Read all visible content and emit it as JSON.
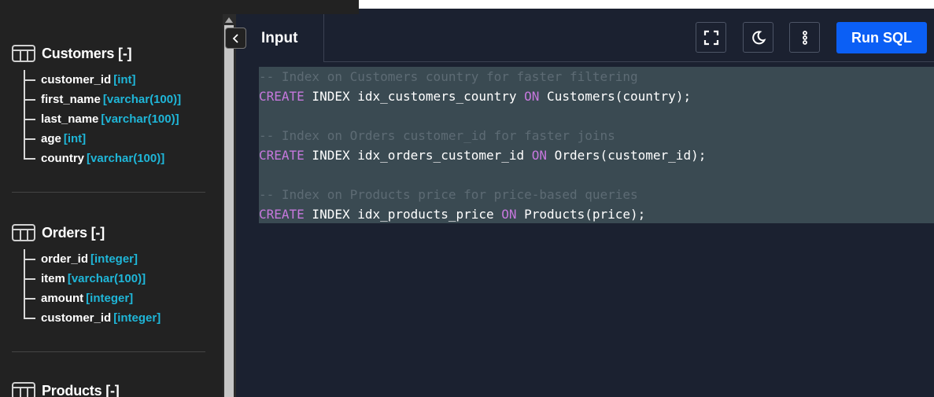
{
  "sidebar": {
    "tables": [
      {
        "name": "Customers [-]",
        "columns": [
          {
            "name": "customer_id",
            "type": "[int]"
          },
          {
            "name": "first_name",
            "type": "[varchar(100)]"
          },
          {
            "name": "last_name",
            "type": "[varchar(100)]"
          },
          {
            "name": "age",
            "type": "[int]"
          },
          {
            "name": "country",
            "type": "[varchar(100)]"
          }
        ]
      },
      {
        "name": "Orders [-]",
        "columns": [
          {
            "name": "order_id",
            "type": "[integer]"
          },
          {
            "name": "item",
            "type": "[varchar(100)]"
          },
          {
            "name": "amount",
            "type": "[integer]"
          },
          {
            "name": "customer_id",
            "type": "[integer]"
          }
        ]
      },
      {
        "name": "Products [-]",
        "columns": []
      }
    ]
  },
  "editor": {
    "tab_label": "Input",
    "run_label": "Run SQL",
    "icons": [
      "chevron-left-icon",
      "fullscreen-icon",
      "moon-icon",
      "more-vertical-icon"
    ],
    "accent_color": "#0b5ff5",
    "lines": [
      [
        {
          "t": "cm",
          "v": "-- Index on Customers country for faster filtering"
        }
      ],
      [
        {
          "t": "kw",
          "v": "CREATE"
        },
        {
          "t": "id",
          "v": " INDEX idx_customers_country "
        },
        {
          "t": "kw",
          "v": "ON"
        },
        {
          "t": "id",
          "v": " Customers(country);"
        }
      ],
      [],
      [
        {
          "t": "cm",
          "v": "-- Index on Orders customer_id for faster joins"
        }
      ],
      [
        {
          "t": "kw",
          "v": "CREATE"
        },
        {
          "t": "id",
          "v": " INDEX idx_orders_customer_id "
        },
        {
          "t": "kw",
          "v": "ON"
        },
        {
          "t": "id",
          "v": " Orders(customer_id);"
        }
      ],
      [],
      [
        {
          "t": "cm",
          "v": "-- Index on Products price for price-based queries"
        }
      ],
      [
        {
          "t": "kw",
          "v": "CREATE"
        },
        {
          "t": "id",
          "v": " INDEX idx_products_price "
        },
        {
          "t": "kw",
          "v": "ON"
        },
        {
          "t": "id",
          "v": " Products(price);"
        }
      ]
    ]
  }
}
